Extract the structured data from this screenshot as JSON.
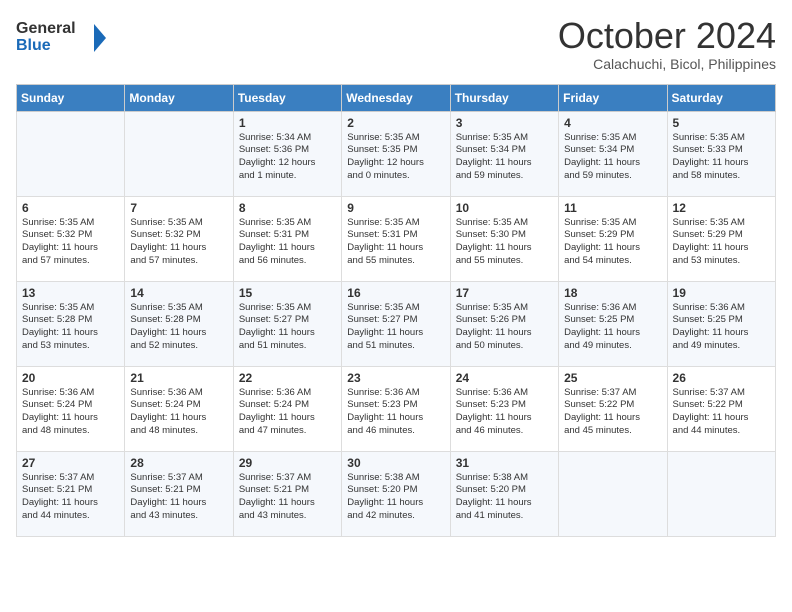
{
  "header": {
    "logo_general": "General",
    "logo_blue": "Blue",
    "month_year": "October 2024",
    "location": "Calachuchi, Bicol, Philippines"
  },
  "days_of_week": [
    "Sunday",
    "Monday",
    "Tuesday",
    "Wednesday",
    "Thursday",
    "Friday",
    "Saturday"
  ],
  "weeks": [
    [
      {
        "day": "",
        "content": ""
      },
      {
        "day": "",
        "content": ""
      },
      {
        "day": "1",
        "content": "Sunrise: 5:34 AM\nSunset: 5:36 PM\nDaylight: 12 hours\nand 1 minute."
      },
      {
        "day": "2",
        "content": "Sunrise: 5:35 AM\nSunset: 5:35 PM\nDaylight: 12 hours\nand 0 minutes."
      },
      {
        "day": "3",
        "content": "Sunrise: 5:35 AM\nSunset: 5:34 PM\nDaylight: 11 hours\nand 59 minutes."
      },
      {
        "day": "4",
        "content": "Sunrise: 5:35 AM\nSunset: 5:34 PM\nDaylight: 11 hours\nand 59 minutes."
      },
      {
        "day": "5",
        "content": "Sunrise: 5:35 AM\nSunset: 5:33 PM\nDaylight: 11 hours\nand 58 minutes."
      }
    ],
    [
      {
        "day": "6",
        "content": "Sunrise: 5:35 AM\nSunset: 5:32 PM\nDaylight: 11 hours\nand 57 minutes."
      },
      {
        "day": "7",
        "content": "Sunrise: 5:35 AM\nSunset: 5:32 PM\nDaylight: 11 hours\nand 57 minutes."
      },
      {
        "day": "8",
        "content": "Sunrise: 5:35 AM\nSunset: 5:31 PM\nDaylight: 11 hours\nand 56 minutes."
      },
      {
        "day": "9",
        "content": "Sunrise: 5:35 AM\nSunset: 5:31 PM\nDaylight: 11 hours\nand 55 minutes."
      },
      {
        "day": "10",
        "content": "Sunrise: 5:35 AM\nSunset: 5:30 PM\nDaylight: 11 hours\nand 55 minutes."
      },
      {
        "day": "11",
        "content": "Sunrise: 5:35 AM\nSunset: 5:29 PM\nDaylight: 11 hours\nand 54 minutes."
      },
      {
        "day": "12",
        "content": "Sunrise: 5:35 AM\nSunset: 5:29 PM\nDaylight: 11 hours\nand 53 minutes."
      }
    ],
    [
      {
        "day": "13",
        "content": "Sunrise: 5:35 AM\nSunset: 5:28 PM\nDaylight: 11 hours\nand 53 minutes."
      },
      {
        "day": "14",
        "content": "Sunrise: 5:35 AM\nSunset: 5:28 PM\nDaylight: 11 hours\nand 52 minutes."
      },
      {
        "day": "15",
        "content": "Sunrise: 5:35 AM\nSunset: 5:27 PM\nDaylight: 11 hours\nand 51 minutes."
      },
      {
        "day": "16",
        "content": "Sunrise: 5:35 AM\nSunset: 5:27 PM\nDaylight: 11 hours\nand 51 minutes."
      },
      {
        "day": "17",
        "content": "Sunrise: 5:35 AM\nSunset: 5:26 PM\nDaylight: 11 hours\nand 50 minutes."
      },
      {
        "day": "18",
        "content": "Sunrise: 5:36 AM\nSunset: 5:25 PM\nDaylight: 11 hours\nand 49 minutes."
      },
      {
        "day": "19",
        "content": "Sunrise: 5:36 AM\nSunset: 5:25 PM\nDaylight: 11 hours\nand 49 minutes."
      }
    ],
    [
      {
        "day": "20",
        "content": "Sunrise: 5:36 AM\nSunset: 5:24 PM\nDaylight: 11 hours\nand 48 minutes."
      },
      {
        "day": "21",
        "content": "Sunrise: 5:36 AM\nSunset: 5:24 PM\nDaylight: 11 hours\nand 48 minutes."
      },
      {
        "day": "22",
        "content": "Sunrise: 5:36 AM\nSunset: 5:24 PM\nDaylight: 11 hours\nand 47 minutes."
      },
      {
        "day": "23",
        "content": "Sunrise: 5:36 AM\nSunset: 5:23 PM\nDaylight: 11 hours\nand 46 minutes."
      },
      {
        "day": "24",
        "content": "Sunrise: 5:36 AM\nSunset: 5:23 PM\nDaylight: 11 hours\nand 46 minutes."
      },
      {
        "day": "25",
        "content": "Sunrise: 5:37 AM\nSunset: 5:22 PM\nDaylight: 11 hours\nand 45 minutes."
      },
      {
        "day": "26",
        "content": "Sunrise: 5:37 AM\nSunset: 5:22 PM\nDaylight: 11 hours\nand 44 minutes."
      }
    ],
    [
      {
        "day": "27",
        "content": "Sunrise: 5:37 AM\nSunset: 5:21 PM\nDaylight: 11 hours\nand 44 minutes."
      },
      {
        "day": "28",
        "content": "Sunrise: 5:37 AM\nSunset: 5:21 PM\nDaylight: 11 hours\nand 43 minutes."
      },
      {
        "day": "29",
        "content": "Sunrise: 5:37 AM\nSunset: 5:21 PM\nDaylight: 11 hours\nand 43 minutes."
      },
      {
        "day": "30",
        "content": "Sunrise: 5:38 AM\nSunset: 5:20 PM\nDaylight: 11 hours\nand 42 minutes."
      },
      {
        "day": "31",
        "content": "Sunrise: 5:38 AM\nSunset: 5:20 PM\nDaylight: 11 hours\nand 41 minutes."
      },
      {
        "day": "",
        "content": ""
      },
      {
        "day": "",
        "content": ""
      }
    ]
  ]
}
